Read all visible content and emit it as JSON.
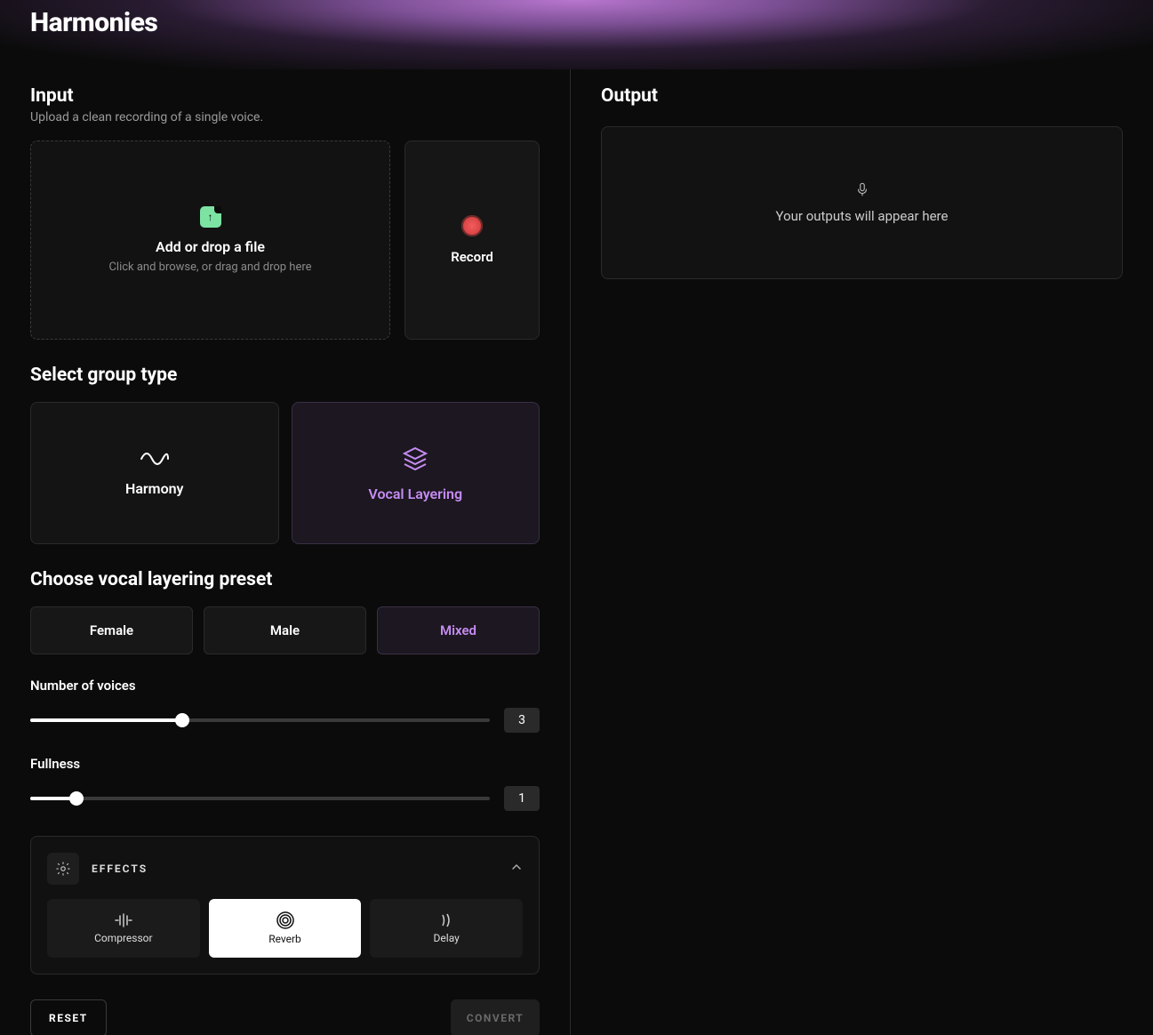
{
  "header": {
    "brand": "Harmonies"
  },
  "input": {
    "title": "Input",
    "subtitle": "Upload a clean recording of a single voice.",
    "dropzone": {
      "title": "Add or drop a file",
      "hint": "Click and browse, or drag and drop here"
    },
    "record_label": "Record"
  },
  "group": {
    "title": "Select group type",
    "options": [
      {
        "label": "Harmony",
        "selected": false
      },
      {
        "label": "Vocal Layering",
        "selected": true
      }
    ]
  },
  "preset": {
    "title": "Choose vocal layering preset",
    "options": [
      {
        "label": "Female",
        "selected": false
      },
      {
        "label": "Male",
        "selected": false
      },
      {
        "label": "Mixed",
        "selected": true
      }
    ]
  },
  "sliders": {
    "voices": {
      "label": "Number of voices",
      "value": "3",
      "fill_pct": 33
    },
    "fullness": {
      "label": "Fullness",
      "value": "1",
      "fill_pct": 10
    }
  },
  "effects": {
    "title": "EFFECTS",
    "items": [
      {
        "label": "Compressor",
        "active": false
      },
      {
        "label": "Reverb",
        "active": true
      },
      {
        "label": "Delay",
        "active": false
      }
    ]
  },
  "actions": {
    "reset": "RESET",
    "convert": "CONVERT"
  },
  "output": {
    "title": "Output",
    "empty_text": "Your outputs will appear here"
  }
}
